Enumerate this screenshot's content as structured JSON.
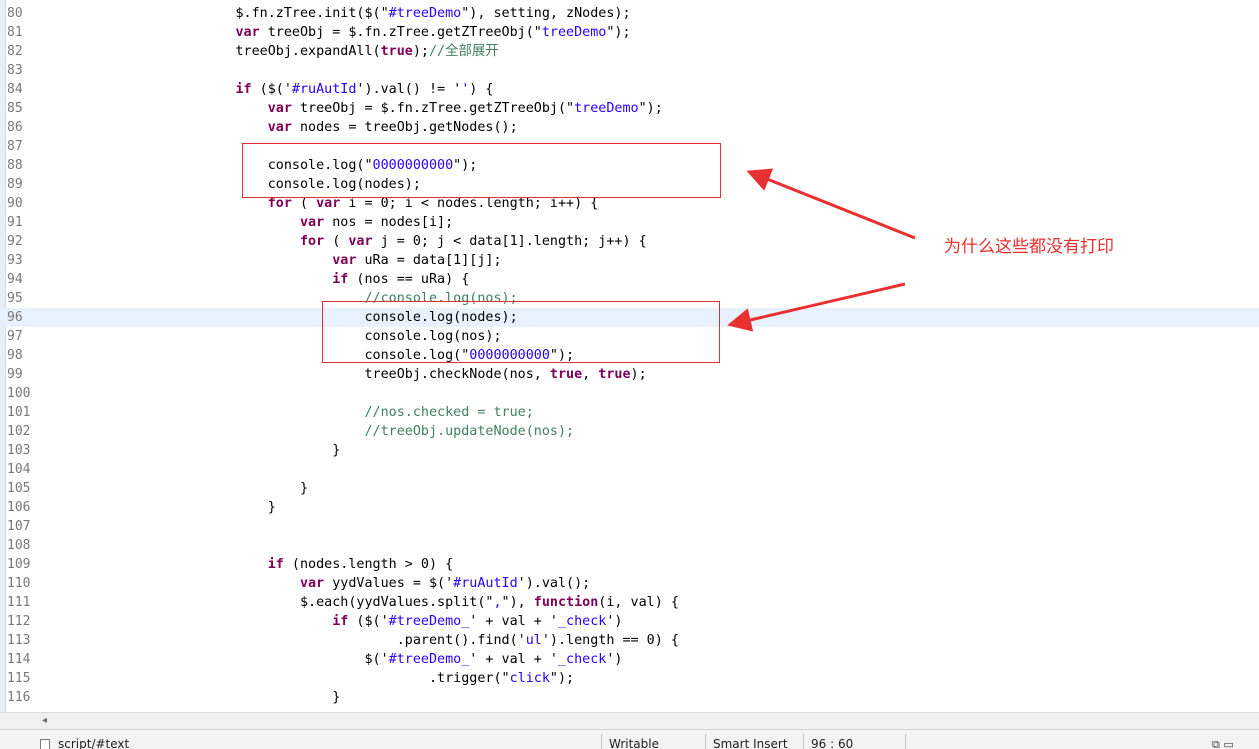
{
  "editor": {
    "current_line": 96,
    "lines": [
      {
        "n": "80",
        "segs": [
          {
            "t": "                        $.fn.zTree.init($(\"",
            "c": ""
          },
          {
            "t": "#treeDemo",
            "c": "str"
          },
          {
            "t": "\"), setting, zNodes);",
            "c": ""
          }
        ]
      },
      {
        "n": "81",
        "segs": [
          {
            "t": "                        ",
            "c": ""
          },
          {
            "t": "var",
            "c": "kw"
          },
          {
            "t": " treeObj = $.fn.zTree.getZTreeObj(\"",
            "c": ""
          },
          {
            "t": "treeDemo",
            "c": "str"
          },
          {
            "t": "\");",
            "c": ""
          }
        ]
      },
      {
        "n": "82",
        "segs": [
          {
            "t": "                        treeObj.expandAll(",
            "c": ""
          },
          {
            "t": "true",
            "c": "kw"
          },
          {
            "t": ");",
            "c": ""
          },
          {
            "t": "//全部展开",
            "c": "cmt"
          }
        ]
      },
      {
        "n": "83",
        "segs": []
      },
      {
        "n": "84",
        "segs": [
          {
            "t": "                        ",
            "c": ""
          },
          {
            "t": "if",
            "c": "kw"
          },
          {
            "t": " ($('",
            "c": ""
          },
          {
            "t": "#ruAutId",
            "c": "str"
          },
          {
            "t": "').val() != '",
            "c": ""
          },
          {
            "t": "'",
            "c": "str"
          },
          {
            "t": ") {",
            "c": ""
          }
        ]
      },
      {
        "n": "85",
        "segs": [
          {
            "t": "                            ",
            "c": ""
          },
          {
            "t": "var",
            "c": "kw"
          },
          {
            "t": " treeObj = $.fn.zTree.getZTreeObj(\"",
            "c": ""
          },
          {
            "t": "treeDemo",
            "c": "str"
          },
          {
            "t": "\");",
            "c": ""
          }
        ]
      },
      {
        "n": "86",
        "segs": [
          {
            "t": "                            ",
            "c": ""
          },
          {
            "t": "var",
            "c": "kw"
          },
          {
            "t": " nodes = treeObj.getNodes();",
            "c": ""
          }
        ]
      },
      {
        "n": "87",
        "segs": []
      },
      {
        "n": "88",
        "segs": [
          {
            "t": "                            console.log(\"",
            "c": ""
          },
          {
            "t": "0000000000",
            "c": "str"
          },
          {
            "t": "\");",
            "c": ""
          }
        ]
      },
      {
        "n": "89",
        "segs": [
          {
            "t": "                            console.log(nodes);",
            "c": ""
          }
        ]
      },
      {
        "n": "90",
        "segs": [
          {
            "t": "                            ",
            "c": ""
          },
          {
            "t": "for",
            "c": "kw"
          },
          {
            "t": " ( ",
            "c": ""
          },
          {
            "t": "var",
            "c": "kw"
          },
          {
            "t": " i = 0; i < nodes.length; i++) {",
            "c": ""
          }
        ]
      },
      {
        "n": "91",
        "segs": [
          {
            "t": "                                ",
            "c": ""
          },
          {
            "t": "var",
            "c": "kw"
          },
          {
            "t": " nos = nodes[i];",
            "c": ""
          }
        ]
      },
      {
        "n": "92",
        "segs": [
          {
            "t": "                                ",
            "c": ""
          },
          {
            "t": "for",
            "c": "kw"
          },
          {
            "t": " ( ",
            "c": ""
          },
          {
            "t": "var",
            "c": "kw"
          },
          {
            "t": " j = 0; j < data[1].length; j++) {",
            "c": ""
          }
        ]
      },
      {
        "n": "93",
        "segs": [
          {
            "t": "                                    ",
            "c": ""
          },
          {
            "t": "var",
            "c": "kw"
          },
          {
            "t": " uRa = data[1][j];",
            "c": ""
          }
        ]
      },
      {
        "n": "94",
        "segs": [
          {
            "t": "                                    ",
            "c": ""
          },
          {
            "t": "if",
            "c": "kw"
          },
          {
            "t": " (nos == uRa) {",
            "c": ""
          }
        ]
      },
      {
        "n": "95",
        "segs": [
          {
            "t": "                                        ",
            "c": ""
          },
          {
            "t": "//console.log(nos);",
            "c": "cmt"
          }
        ]
      },
      {
        "n": "96",
        "segs": [
          {
            "t": "                                        console.log(nodes);",
            "c": ""
          }
        ]
      },
      {
        "n": "97",
        "segs": [
          {
            "t": "                                        console.log(nos);",
            "c": ""
          }
        ]
      },
      {
        "n": "98",
        "segs": [
          {
            "t": "                                        console.log(\"",
            "c": ""
          },
          {
            "t": "0000000000",
            "c": "str"
          },
          {
            "t": "\");",
            "c": ""
          }
        ]
      },
      {
        "n": "99",
        "segs": [
          {
            "t": "                                        treeObj.checkNode(nos, ",
            "c": ""
          },
          {
            "t": "true",
            "c": "kw"
          },
          {
            "t": ", ",
            "c": ""
          },
          {
            "t": "true",
            "c": "kw"
          },
          {
            "t": ");",
            "c": ""
          }
        ]
      },
      {
        "n": "100",
        "segs": []
      },
      {
        "n": "101",
        "segs": [
          {
            "t": "                                        ",
            "c": ""
          },
          {
            "t": "//nos.checked = true;",
            "c": "cmt"
          }
        ]
      },
      {
        "n": "102",
        "segs": [
          {
            "t": "                                        ",
            "c": ""
          },
          {
            "t": "//treeObj.updateNode(nos);",
            "c": "cmt"
          }
        ]
      },
      {
        "n": "103",
        "segs": [
          {
            "t": "                                    }",
            "c": ""
          }
        ]
      },
      {
        "n": "104",
        "segs": []
      },
      {
        "n": "105",
        "segs": [
          {
            "t": "                                }",
            "c": ""
          }
        ]
      },
      {
        "n": "106",
        "segs": [
          {
            "t": "                            }",
            "c": ""
          }
        ]
      },
      {
        "n": "107",
        "segs": []
      },
      {
        "n": "108",
        "segs": []
      },
      {
        "n": "109",
        "segs": [
          {
            "t": "                            ",
            "c": ""
          },
          {
            "t": "if",
            "c": "kw"
          },
          {
            "t": " (nodes.length > 0) {",
            "c": ""
          }
        ]
      },
      {
        "n": "110",
        "segs": [
          {
            "t": "                                ",
            "c": ""
          },
          {
            "t": "var",
            "c": "kw"
          },
          {
            "t": " yydValues = $('",
            "c": ""
          },
          {
            "t": "#ruAutId",
            "c": "str"
          },
          {
            "t": "').val();",
            "c": ""
          }
        ]
      },
      {
        "n": "111",
        "segs": [
          {
            "t": "                                $.each(yydValues.split(\"",
            "c": ""
          },
          {
            "t": ",",
            "c": "str"
          },
          {
            "t": "\"), ",
            "c": ""
          },
          {
            "t": "function",
            "c": "kw"
          },
          {
            "t": "(i, val) {",
            "c": ""
          }
        ]
      },
      {
        "n": "112",
        "segs": [
          {
            "t": "                                    ",
            "c": ""
          },
          {
            "t": "if",
            "c": "kw"
          },
          {
            "t": " ($('",
            "c": ""
          },
          {
            "t": "#treeDemo_",
            "c": "str"
          },
          {
            "t": "' + val + '",
            "c": ""
          },
          {
            "t": "_check",
            "c": "str"
          },
          {
            "t": "')",
            "c": ""
          }
        ]
      },
      {
        "n": "113",
        "segs": [
          {
            "t": "                                            .parent().find('",
            "c": ""
          },
          {
            "t": "ul",
            "c": "str"
          },
          {
            "t": "').length == 0) {",
            "c": ""
          }
        ]
      },
      {
        "n": "114",
        "segs": [
          {
            "t": "                                        $('",
            "c": ""
          },
          {
            "t": "#treeDemo_",
            "c": "str"
          },
          {
            "t": "' + val + '",
            "c": ""
          },
          {
            "t": "_check",
            "c": "str"
          },
          {
            "t": "')",
            "c": ""
          }
        ]
      },
      {
        "n": "115",
        "segs": [
          {
            "t": "                                                .trigger(\"",
            "c": ""
          },
          {
            "t": "click",
            "c": "str"
          },
          {
            "t": "\");",
            "c": ""
          }
        ]
      },
      {
        "n": "116",
        "segs": [
          {
            "t": "                                    }",
            "c": ""
          }
        ]
      }
    ]
  },
  "annotation": {
    "note": "为什么这些都没有打印",
    "color": "#e83030"
  },
  "hscroll": {
    "left_arrow": "◂"
  },
  "statusbar": {
    "path": "script/#text",
    "mode": "Writable",
    "insert": "Smart Insert",
    "position": "96 : 60",
    "corner_icons": "⧉ ▭"
  }
}
